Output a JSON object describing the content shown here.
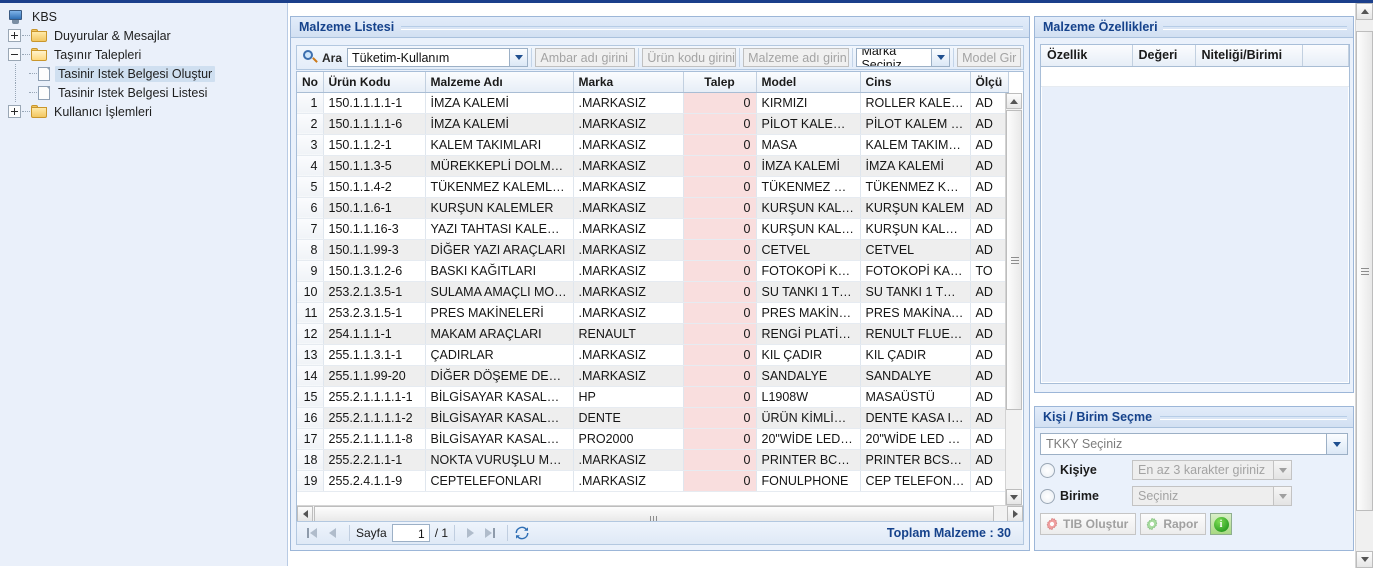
{
  "app": {
    "title": "KBS"
  },
  "sidebar": {
    "root_label": "KBS",
    "items": [
      {
        "label": "Duyurular & Mesajlar",
        "icon": "folder-icon",
        "expander": "plus"
      },
      {
        "label": "Taşınır Talepleri",
        "icon": "folder-open-icon",
        "expander": "minus"
      },
      {
        "label": "Tasinir Istek Belgesi Oluştur",
        "icon": "document-icon",
        "selected": true
      },
      {
        "label": "Tasinir Istek Belgesi Listesi",
        "icon": "document-icon",
        "selected": false
      },
      {
        "label": "Kullanıcı İşlemleri",
        "icon": "folder-icon",
        "expander": "plus"
      }
    ]
  },
  "main_panel": {
    "title": "Malzeme Listesi",
    "toolbar": {
      "search_label": "Ara",
      "search_icon": "magnifier-icon",
      "type_select_value": "Tüketim-Kullanım",
      "warehouse_placeholder": "Ambar adı girini",
      "product_code_placeholder": "Ürün kodu girini",
      "material_name_placeholder": "Malzeme adı girin",
      "brand_select_value": "Marka Seçiniz",
      "model_placeholder": "Model Gir"
    },
    "grid": {
      "columns": [
        "No",
        "Ürün Kodu",
        "Malzeme Adı",
        "Marka",
        "Talep",
        "Model",
        "Cins",
        "Ölçü"
      ],
      "rows": [
        [
          "1",
          "150.1.1.1.1-1",
          "İMZA KALEMİ",
          ".MARKASIZ",
          "0",
          "KIRMIZI",
          "ROLLER KALE…",
          "AD"
        ],
        [
          "2",
          "150.1.1.1.1-6",
          "İMZA KALEMİ",
          ".MARKASIZ",
          "0",
          "PİLOT KALEM …",
          "PİLOT KALEM …",
          "AD"
        ],
        [
          "3",
          "150.1.1.2-1",
          "KALEM TAKIMLARI",
          ".MARKASIZ",
          "0",
          "MASA",
          "KALEM TAKIML…",
          "AD"
        ],
        [
          "4",
          "150.1.1.3-5",
          "MÜREKKEPLİ DOLMA K…",
          ".MARKASIZ",
          "0",
          "İMZA KALEMİ",
          "İMZA KALEMİ",
          "AD"
        ],
        [
          "5",
          "150.1.1.4-2",
          "TÜKENMEZ KALEMLER",
          ".MARKASIZ",
          "0",
          "TÜKENMEZ KA…",
          "TÜKENMEZ KA…",
          "AD"
        ],
        [
          "6",
          "150.1.1.6-1",
          "KURŞUN KALEMLER",
          ".MARKASIZ",
          "0",
          "KURŞUN KALEM",
          "KURŞUN KALEM",
          "AD"
        ],
        [
          "7",
          "150.1.1.16-3",
          "YAZI TAHTASI KALEMLERİ",
          ".MARKASIZ",
          "0",
          "KURŞUN KALEM",
          "KURŞUN KAL…",
          "AD"
        ],
        [
          "8",
          "150.1.1.99-3",
          "DİĞER YAZI ARAÇLARI",
          ".MARKASIZ",
          "0",
          "CETVEL",
          "CETVEL",
          "AD"
        ],
        [
          "9",
          "150.1.3.1.2-6",
          "BASKI KAĞITLARI",
          ".MARKASIZ",
          "0",
          "FOTOKOPİ KA…",
          "FOTOKOPİ KA…",
          "TO"
        ],
        [
          "10",
          "253.2.1.3.5-1",
          "SULAMA AMAÇLI MOTO…",
          ".MARKASIZ",
          "0",
          "SU TANKI 1 TO…",
          "SU TANKI 1 TO…",
          "AD"
        ],
        [
          "11",
          "253.2.3.1.5-1",
          "PRES MAKİNELERİ",
          ".MARKASIZ",
          "0",
          "PRES MAKİNA…",
          "PRES MAKİNA…",
          "AD"
        ],
        [
          "12",
          "254.1.1.1-1",
          "MAKAM ARAÇLARI",
          "RENAULT",
          "0",
          "RENGİ PLATİN…",
          "RENULT FLUE…",
          "AD"
        ],
        [
          "13",
          "255.1.1.3.1-1",
          "ÇADIRLAR",
          ".MARKASIZ",
          "0",
          "KIL ÇADIR",
          "KIL ÇADIR",
          "AD"
        ],
        [
          "14",
          "255.1.1.99-20",
          "DİĞER DÖŞEME DEMİR…",
          ".MARKASIZ",
          "0",
          "SANDALYE",
          "SANDALYE",
          "AD"
        ],
        [
          "15",
          "255.2.1.1.1.1-1",
          "BİLGİSAYAR KASALARI",
          "HP",
          "0",
          "L1908W",
          "MASAÜSTÜ",
          "AD"
        ],
        [
          "16",
          "255.2.1.1.1.1-2",
          "BİLGİSAYAR KASALARI",
          "DENTE",
          "0",
          "ÜRÜN KİMLİĞİ…",
          "DENTE KASA I…",
          "AD"
        ],
        [
          "17",
          "255.2.1.1.1.1-8",
          "BİLGİSAYAR KASALARI",
          "PRO2000",
          "0",
          "20\"WİDE LED …",
          "20\"WİDE LED …",
          "AD"
        ],
        [
          "18",
          "255.2.2.1.1-1",
          "NOKTA VURUŞLU MATRİ…",
          ".MARKASIZ",
          "0",
          "PRINTER BCS…",
          "PRINTER BCS…",
          "AD"
        ],
        [
          "19",
          "255.2.4.1.1-9",
          "CEPTELEFONLARI",
          ".MARKASIZ",
          "0",
          "FONULPHONE",
          "CEP TELEFON…",
          "AD"
        ]
      ]
    },
    "pager": {
      "first_icon": "first-page-icon",
      "prev_icon": "prev-page-icon",
      "page_label": "Sayfa",
      "page_value": "1",
      "page_total": "/ 1",
      "next_icon": "next-page-icon",
      "last_icon": "last-page-icon",
      "refresh_icon": "refresh-icon",
      "total_text": "Toplam Malzeme : 30"
    }
  },
  "props_panel": {
    "title": "Malzeme Özellikleri",
    "columns": [
      "Özellik",
      "Değeri",
      "Niteliği/Birimi",
      ""
    ]
  },
  "kisi_panel": {
    "title": "Kişi / Birim Seçme",
    "tkky_placeholder": "TKKY Seçiniz",
    "person_radio_label": "Kişiye",
    "person_placeholder": "En az 3 karakter giriniz",
    "unit_radio_label": "Birime",
    "unit_placeholder": "Seçiniz",
    "tib_button_label": "TIB Oluştur",
    "report_button_label": "Rapor",
    "info_button_label": "i"
  },
  "colors": {
    "accent": "#15428b",
    "panel_bg": "#eaf1fb",
    "talep_cell": "#f9dede",
    "row_even": "#eeeeee",
    "top_strip": "#1b3f8b"
  }
}
